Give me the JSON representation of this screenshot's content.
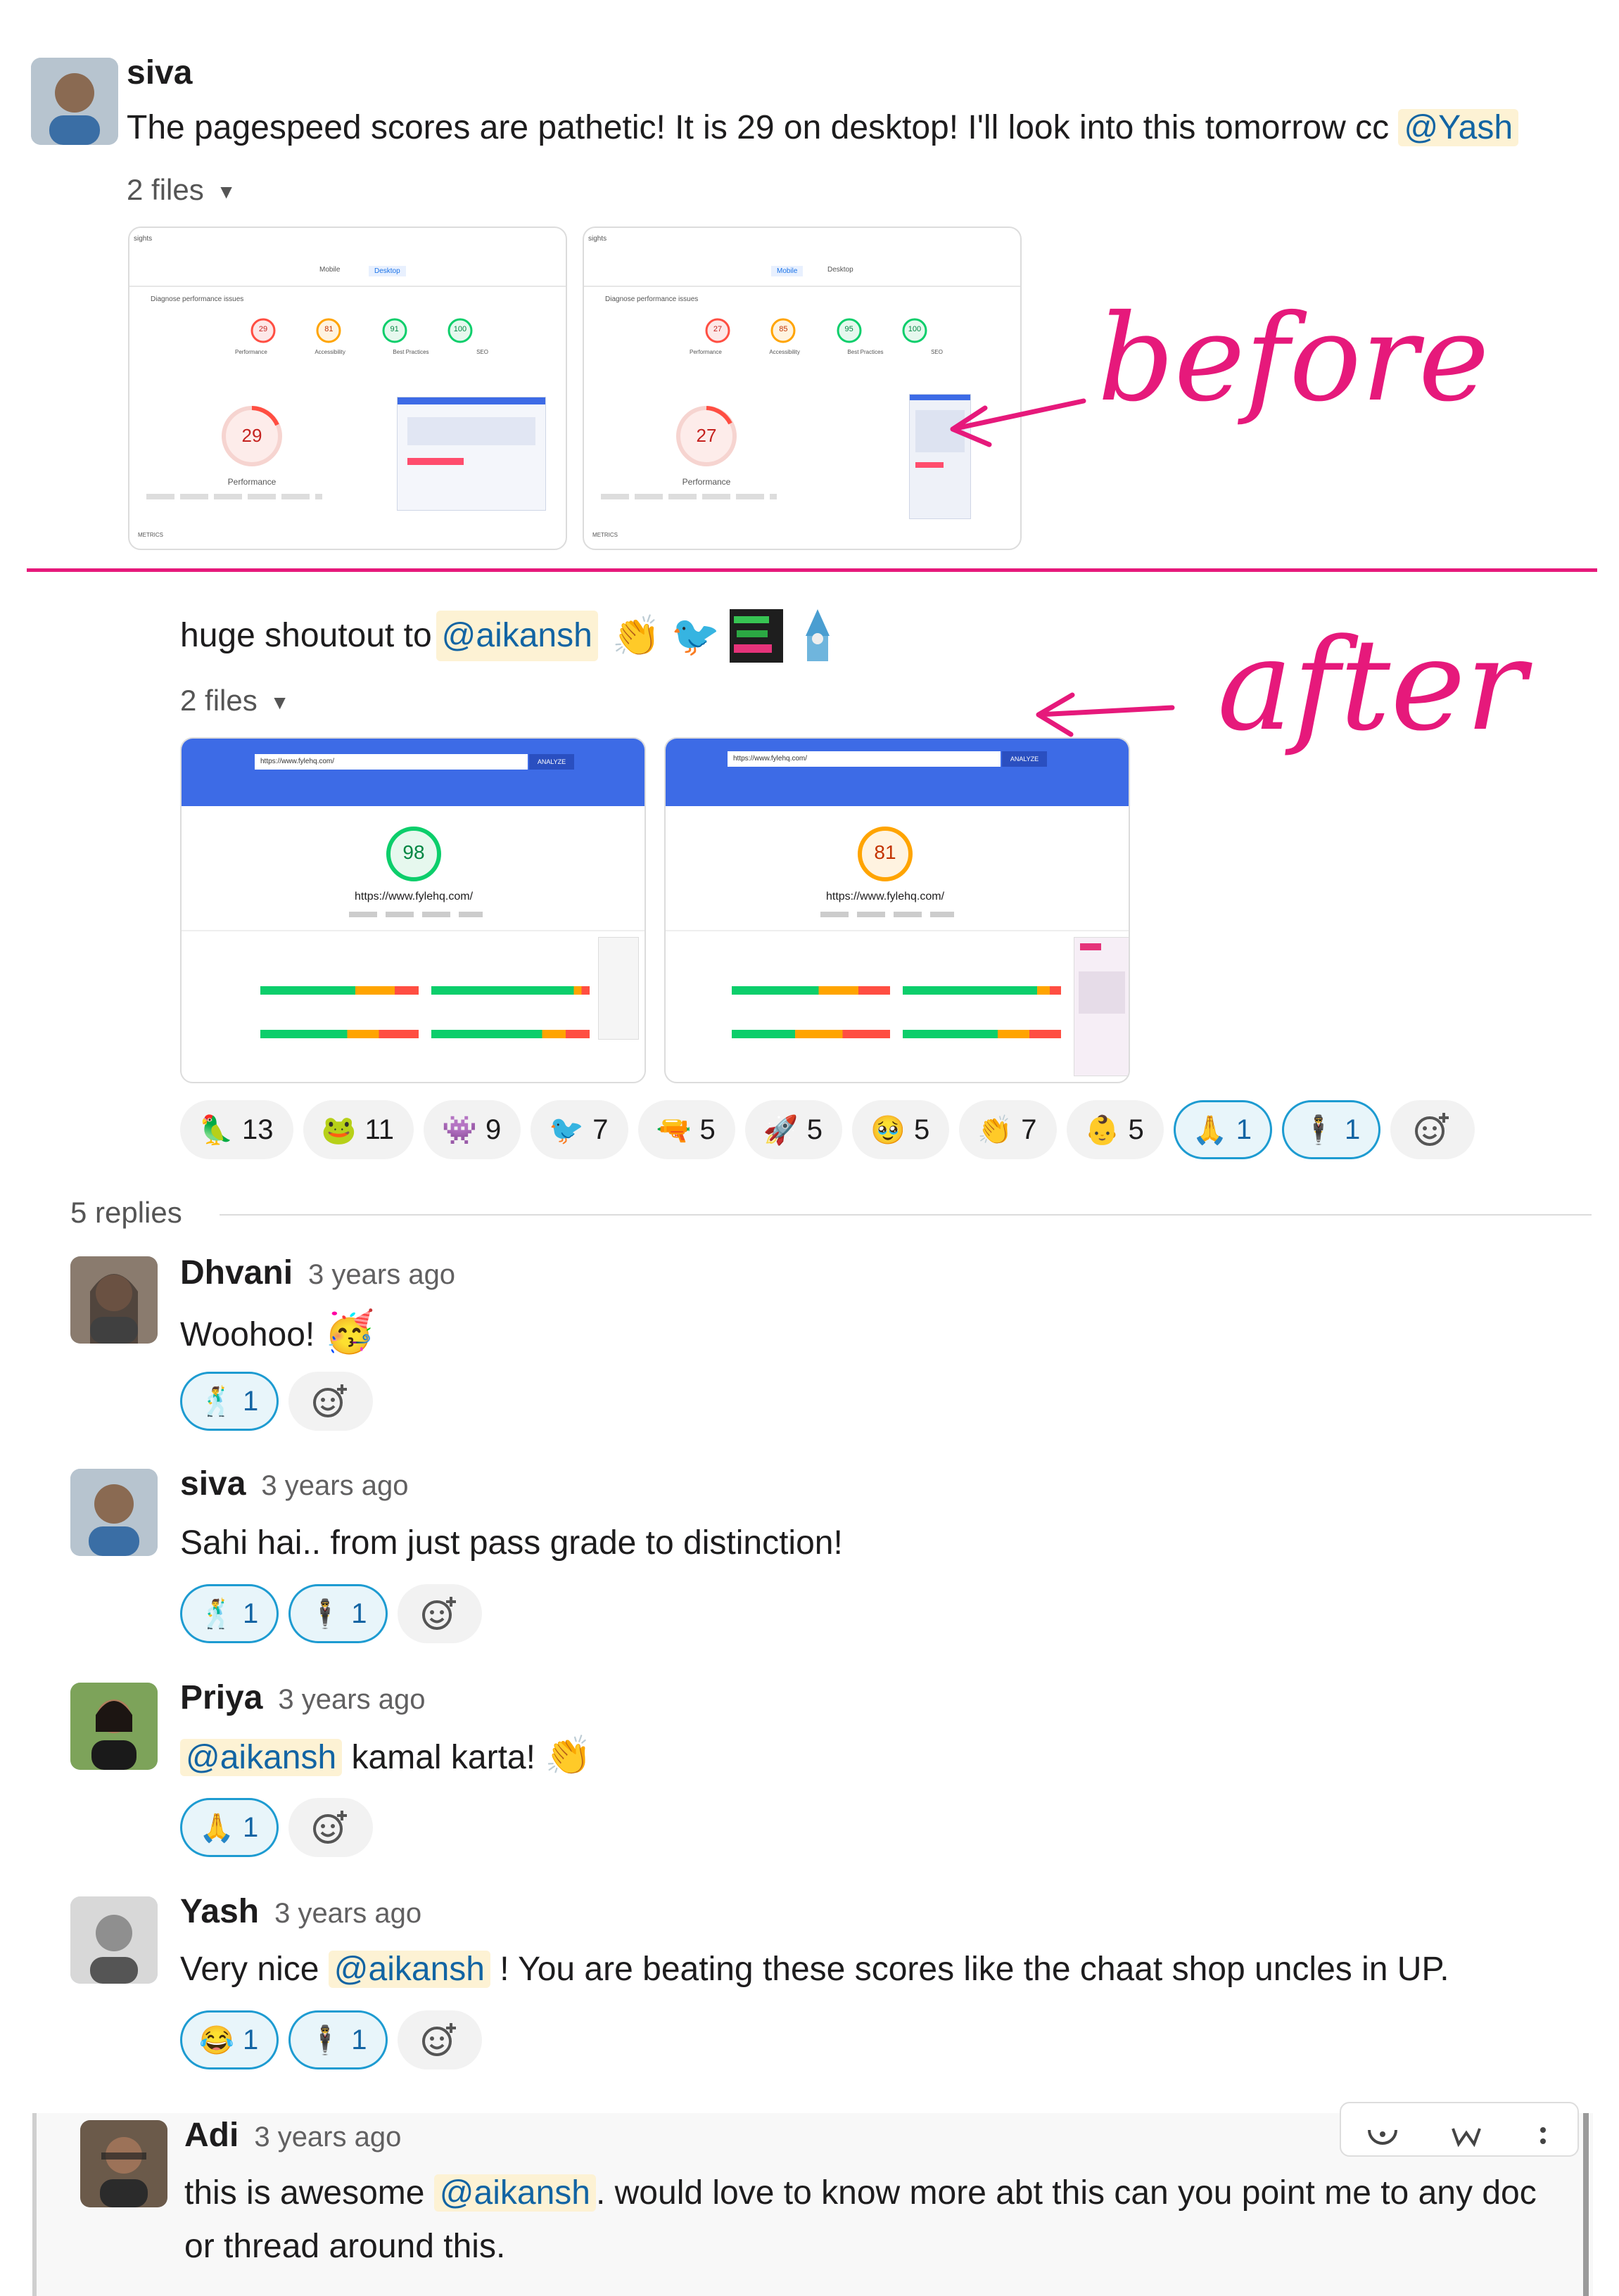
{
  "colors": {
    "annotation": "#e6197b",
    "mention_bg": "#fdf2d4",
    "mention_text": "#1264a3",
    "reaction_mine_bg": "#e8f5fa",
    "reaction_mine_border": "#1d9bd1"
  },
  "parent": {
    "author": "siva",
    "text_before": "The pagespeed scores are pathetic! It is 29 on desktop! I'll look into this tomorrow cc ",
    "mention": "@Yash",
    "files_toggle": "2 files",
    "before_screenshots": [
      {
        "tab_left": "Mobile",
        "tab_right": "Desktop",
        "header": "sights",
        "diagnose": "Diagnose performance issues",
        "scores": [
          "29",
          "81",
          "91",
          "100"
        ],
        "score_labels": [
          "Performance",
          "Accessibility",
          "Best Practices",
          "SEO"
        ],
        "big_score": "29",
        "big_label": "Performance",
        "footer": "METRICS"
      },
      {
        "tab_left": "Mobile",
        "tab_right": "Desktop",
        "header": "sights",
        "diagnose": "Diagnose performance issues",
        "scores": [
          "27",
          "85",
          "95",
          "100"
        ],
        "score_labels": [
          "Performance",
          "Accessibility",
          "Best Practices",
          "SEO"
        ],
        "big_score": "27",
        "big_label": "Performance",
        "footer": "METRICS"
      }
    ]
  },
  "annotations": {
    "before": "before",
    "after": "after"
  },
  "shoutout": {
    "text": "huge shoutout to ",
    "mention": "@aikansh",
    "emojis": [
      "clap-emoji",
      "bird-emoji",
      "parrot-emoji",
      "wizard-emoji"
    ],
    "files_toggle": "2 files",
    "after_screenshots": [
      {
        "url_input": "https://www.fylehq.com/",
        "button": "ANALYZE",
        "score": "98",
        "url": "https://www.fylehq.com/",
        "score_color": "#0cce6b"
      },
      {
        "url_input": "https://www.fylehq.com/",
        "button": "ANALYZE",
        "score": "81",
        "url": "https://www.fylehq.com/",
        "score_color": "#ffa400"
      }
    ],
    "reactions": [
      {
        "emoji": "🦜",
        "count": "13",
        "mine": false
      },
      {
        "emoji": "🐸",
        "count": "11",
        "mine": false
      },
      {
        "emoji": "👾",
        "count": "9",
        "mine": false
      },
      {
        "emoji": "🐦",
        "count": "7",
        "mine": false
      },
      {
        "emoji": "🔫",
        "count": "5",
        "mine": false
      },
      {
        "emoji": "🚀",
        "count": "5",
        "mine": false
      },
      {
        "emoji": "🥹",
        "count": "5",
        "mine": false
      },
      {
        "emoji": "👏",
        "count": "7",
        "mine": false
      },
      {
        "emoji": "👶",
        "count": "5",
        "mine": false
      },
      {
        "emoji": "🙏",
        "count": "1",
        "mine": true
      },
      {
        "emoji": "🕴",
        "count": "1",
        "mine": true
      }
    ]
  },
  "thread": {
    "replies_label": "5 replies",
    "replies": [
      {
        "author": "Dhvani",
        "time": "3 years ago",
        "text": "Woohoo! ",
        "emoji": "🥳",
        "reactions": [
          {
            "emoji": "🕺",
            "count": "1"
          }
        ]
      },
      {
        "author": "siva",
        "time": "3 years ago",
        "text": "Sahi hai.. from just pass grade to distinction!",
        "reactions": [
          {
            "emoji": "🕺",
            "count": "1"
          },
          {
            "emoji": "🕴",
            "count": "1"
          }
        ]
      },
      {
        "author": "Priya",
        "time": "3 years ago",
        "mention": "@aikansh",
        "text": " kamal karta! ",
        "emoji": "👏",
        "reactions": [
          {
            "emoji": "🙏",
            "count": "1"
          }
        ]
      },
      {
        "author": "Yash",
        "time": "3 years ago",
        "text_before": "Very nice ",
        "mention": "@aikansh",
        "text_after": " ! You are beating these scores like the chaat shop uncles in UP.",
        "reactions": [
          {
            "emoji": "😂",
            "count": "1"
          },
          {
            "emoji": "🕴",
            "count": "1"
          }
        ]
      },
      {
        "author": "Adi",
        "time": "3 years ago",
        "text_before": "this is awesome ",
        "mention": "@aikansh",
        "text_after": ". would love to know more abt this can you point me to any doc",
        "text_line2": "or thread around this."
      }
    ]
  }
}
